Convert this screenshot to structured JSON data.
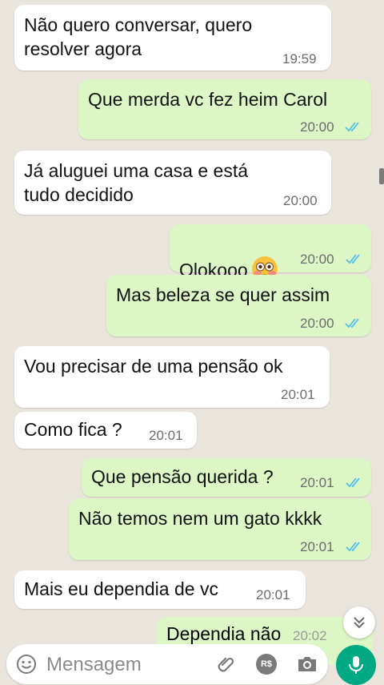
{
  "messages": [
    {
      "text": "Não quero conversar, quero\nresolver agora",
      "time": "19:59",
      "direction": "in"
    },
    {
      "text": "Que merda vc fez heim Carol",
      "time": "20:00",
      "direction": "out",
      "status": "read"
    },
    {
      "text": "Já aluguei uma casa e está\ntudo decidido",
      "time": "20:00",
      "direction": "in"
    },
    {
      "text": "Olokooo",
      "emoji": "flushed-face",
      "time": "20:00",
      "direction": "out",
      "status": "read"
    },
    {
      "text": "Mas beleza se quer assim",
      "time": "20:00",
      "direction": "out",
      "status": "read"
    },
    {
      "text": "Vou precisar de uma pensão ok",
      "time": "20:01",
      "direction": "in"
    },
    {
      "text": "Como fica ?",
      "time": "20:01",
      "direction": "in"
    },
    {
      "text": "Que pensão querida ?",
      "time": "20:01",
      "direction": "out",
      "status": "read"
    },
    {
      "text": "Não temos nem um gato kkkk",
      "time": "20:01",
      "direction": "out",
      "status": "read"
    },
    {
      "text": "Mais eu dependia de vc",
      "time": "20:01",
      "direction": "in"
    },
    {
      "text": "Dependia não",
      "time": "20:02",
      "direction": "out",
      "partial": true
    }
  ],
  "composer": {
    "placeholder": "Mensagem",
    "icons": [
      "emoji-icon",
      "attach-icon",
      "payment-icon",
      "camera-icon",
      "mic-icon"
    ],
    "payment_label": "R$"
  },
  "colors": {
    "background": "#e9e4dc",
    "incoming": "#ffffff",
    "outgoing": "#dcf7c5",
    "read_ticks": "#53bdeb",
    "accent": "#00a884"
  }
}
